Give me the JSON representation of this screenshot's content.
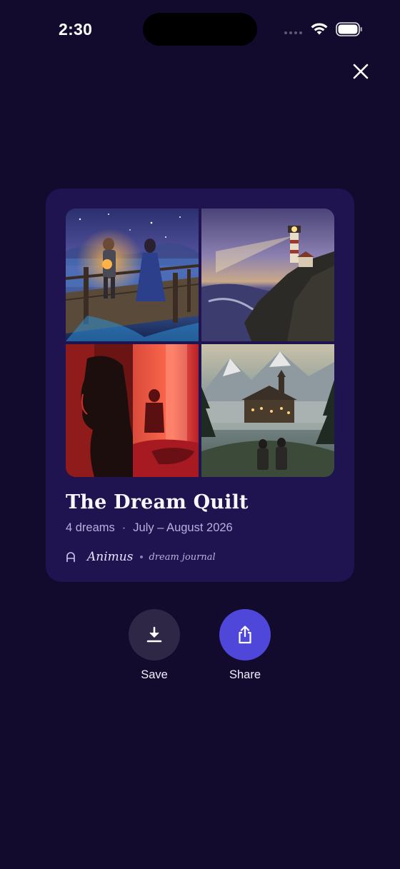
{
  "status_bar": {
    "time": "2:30"
  },
  "close_icon_name": "close-icon",
  "card": {
    "title": "The Dream Quilt",
    "dream_count": "4 dreams",
    "separator": "·",
    "date_range": "July – August 2026",
    "brand_name": "Animus",
    "brand_tagline": "dream journal",
    "background": "#1f1450"
  },
  "quilt_tiles": [
    {
      "name": "couple-bridge-night",
      "icon": "image"
    },
    {
      "name": "lighthouse-cliff",
      "icon": "image"
    },
    {
      "name": "red-silhouette-figures",
      "icon": "image"
    },
    {
      "name": "mountain-castle-travelers",
      "icon": "image"
    }
  ],
  "actions": {
    "save_label": "Save",
    "share_label": "Share",
    "save_icon": "download-icon",
    "share_icon": "share-icon",
    "share_color": "#4f47d9",
    "save_color": "#2e2745"
  },
  "colors": {
    "background": "#120b2e",
    "accent": "#4f47d9"
  }
}
